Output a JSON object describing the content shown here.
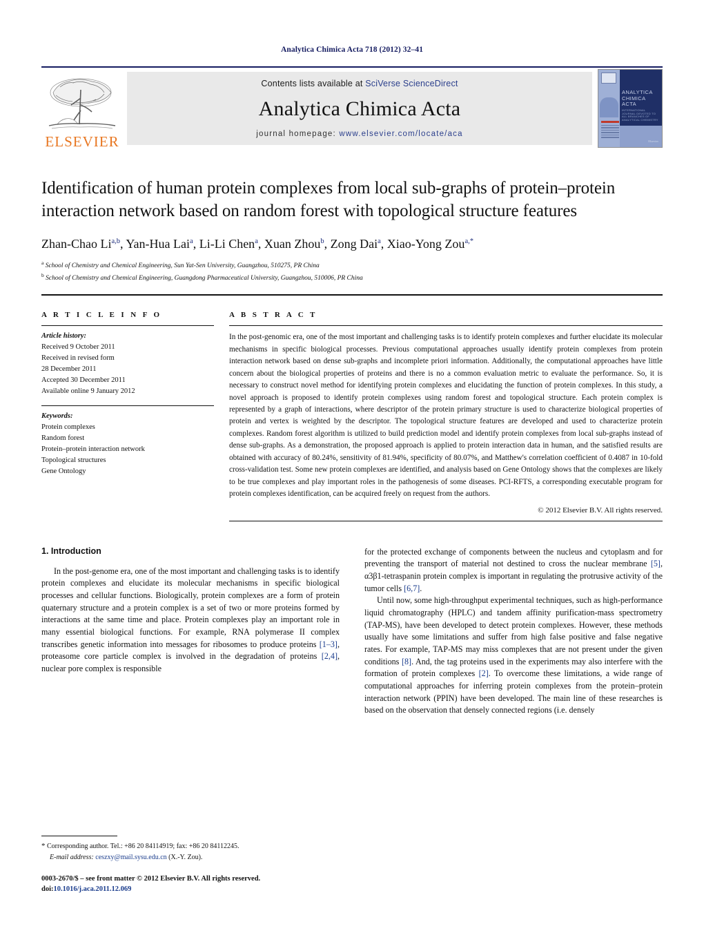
{
  "running_head": "Analytica Chimica Acta 718 (2012) 32–41",
  "masthead": {
    "publisher_logo_label": "ELSEVIER",
    "contents_prefix": "Contents lists available at ",
    "contents_link": "SciVerse ScienceDirect",
    "journal_title": "Analytica Chimica Acta",
    "homepage_prefix": "journal homepage: ",
    "homepage_url": "www.elsevier.com/locate/aca",
    "cover": {
      "title_line1": "ANALYTICA",
      "title_line2": "CHIMICA ACTA",
      "subtitle": "INTERNATIONAL JOURNAL DEVOTED TO ALL BRANCHES OF ANALYTICAL CHEMISTRY",
      "signature": "Elsevier"
    }
  },
  "article": {
    "title": "Identification of human protein complexes from local sub-graphs of protein–protein interaction network based on random forest with topological structure features",
    "authors_html": "Zhan-Chao Li<sup>a,b</sup>, Yan-Hua Lai<sup>a</sup>, Li-Li Chen<sup>a</sup>, Xuan Zhou<sup>b</sup>, Zong Dai<sup>a</sup>, Xiao-Yong Zou<sup>a,</sup><sup>*</sup>",
    "affiliation_a": "School of Chemistry and Chemical Engineering, Sun Yat-Sen University, Guangzhou, 510275, PR China",
    "affiliation_b": "School of Chemistry and Chemical Engineering, Guangdong Pharmaceutical University, Guangzhou, 510006, PR China"
  },
  "article_info": {
    "heading": "A R T I C L E    I N F O",
    "history_label": "Article history:",
    "history_lines": [
      "Received 9 October 2011",
      "Received in revised form",
      "28 December 2011",
      "Accepted 30 December 2011",
      "Available online 9 January 2012"
    ],
    "keywords_label": "Keywords:",
    "keywords": [
      "Protein complexes",
      "Random forest",
      "Protein–protein interaction network",
      "Topological structures",
      "Gene Ontology"
    ]
  },
  "abstract": {
    "heading": "A B S T R A C T",
    "text": "In the post-genomic era, one of the most important and challenging tasks is to identify protein complexes and further elucidate its molecular mechanisms in specific biological processes. Previous computational approaches usually identify protein complexes from protein interaction network based on dense sub-graphs and incomplete priori information. Additionally, the computational approaches have little concern about the biological properties of proteins and there is no a common evaluation metric to evaluate the performance. So, it is necessary to construct novel method for identifying protein complexes and elucidating the function of protein complexes. In this study, a novel approach is proposed to identify protein complexes using random forest and topological structure. Each protein complex is represented by a graph of interactions, where descriptor of the protein primary structure is used to characterize biological properties of protein and vertex is weighted by the descriptor. The topological structure features are developed and used to characterize protein complexes. Random forest algorithm is utilized to build prediction model and identify protein complexes from local sub-graphs instead of dense sub-graphs. As a demonstration, the proposed approach is applied to protein interaction data in human, and the satisfied results are obtained with accuracy of 80.24%, sensitivity of 81.94%, specificity of 80.07%, and Matthew's correlation coefficient of 0.4087 in 10-fold cross-validation test. Some new protein complexes are identified, and analysis based on Gene Ontology shows that the complexes are likely to be true complexes and play important roles in the pathogenesis of some diseases. PCI-RFTS, a corresponding executable program for protein complexes identification, can be acquired freely on request from the authors.",
    "copyright": "© 2012 Elsevier B.V. All rights reserved."
  },
  "introduction": {
    "heading": "1.  Introduction",
    "left_para1_html": "In the post-genome era, one of the most important and challenging tasks is to identify protein complexes and elucidate its molecular mechanisms in specific biological processes and cellular functions. Biologically, protein complexes are a form of protein quaternary structure and a protein complex is a set of two or more proteins formed by interactions at the same time and place. Protein complexes play an important role in many essential biological functions. For example, RNA polymerase II complex transcribes genetic information into messages for ribosomes to produce proteins <span class=\"ref\">[1–3]</span>, proteasome core particle complex is involved in the degradation of proteins <span class=\"ref\">[2,4]</span>, nuclear pore complex is responsible",
    "right_para1_html": "for the protected exchange of components between the nucleus and cytoplasm and for preventing the transport of material not destined to cross the nuclear membrane <span class=\"ref\">[5]</span>, α3β1-tetraspanin protein complex is important in regulating the protrusive activity of the tumor cells <span class=\"ref\">[6,7]</span>.",
    "right_para2_html": "Until now, some high-throughput experimental techniques, such as high-performance liquid chromatography (HPLC) and tandem affinity purification-mass spectrometry (TAP-MS), have been developed to detect protein complexes. However, these methods usually have some limitations and suffer from high false positive and false negative rates. For example, TAP-MS may miss complexes that are not present under the given conditions <span class=\"ref\">[8]</span>. And, the tag proteins used in the experiments may also interfere with the formation of protein complexes <span class=\"ref\">[2]</span>. To overcome these limitations, a wide range of computational approaches for inferring protein complexes from the protein–protein interaction network (PPIN) have been developed. The main line of these researches is based on the observation that densely connected regions (i.e. densely"
  },
  "footnote": {
    "corresponding_html": "<span style=\"font-size:11px\">*</span> Corresponding author. Tel.: +86 20 84114919; fax: +86 20 84112245.",
    "email_html": "<span class=\"ital\">E-mail address:</span> <span class=\"mail\">ceszxy@mail.sysu.edu.cn</span> (X.-Y. Zou)."
  },
  "imprint": {
    "line1": "0003-2670/$ – see front matter © 2012 Elsevier B.V. All rights reserved.",
    "doi_label": "doi:",
    "doi_value": "10.1016/j.aca.2011.12.069"
  },
  "colors": {
    "navy": "#141b60",
    "link_blue": "#2b3f8c",
    "ref_blue": "#1a3c8c",
    "elsevier_orange": "#e87722",
    "masthead_grey": "#e9e9e9"
  }
}
